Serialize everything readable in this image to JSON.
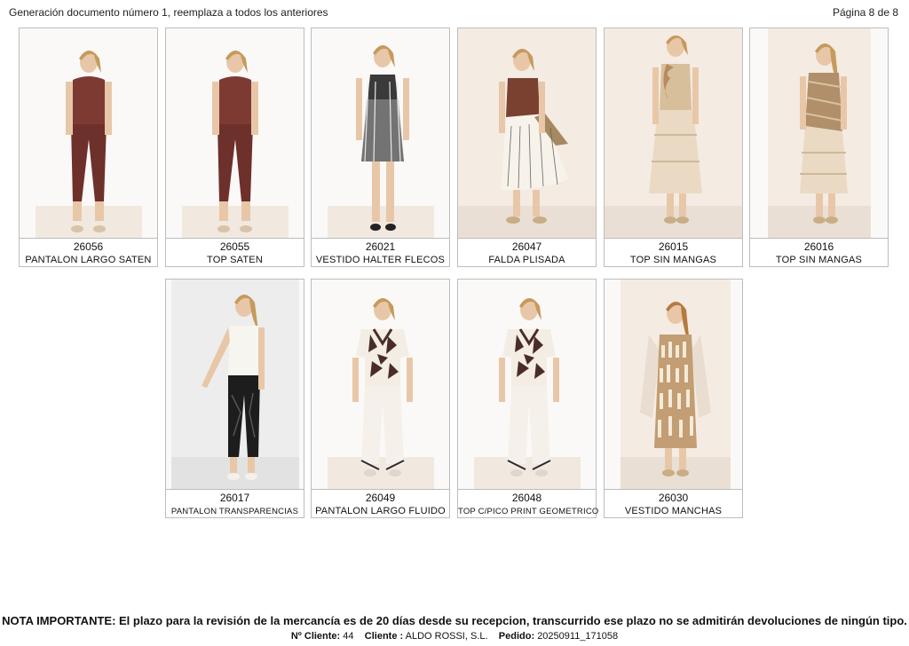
{
  "header": {
    "title": "Generación documento número 1, reemplaza a todos los anteriores",
    "page": "Página 8 de 8"
  },
  "products": [
    {
      "code": "26056",
      "name": "PANTALON LARGO SATEN",
      "photo": "model-wearing-pantalon-largo-saten"
    },
    {
      "code": "26055",
      "name": "TOP SATEN",
      "photo": "model-wearing-top-saten"
    },
    {
      "code": "26021",
      "name": "VESTIDO HALTER FLECOS",
      "photo": "model-wearing-vestido-halter-flecos"
    },
    {
      "code": "26047",
      "name": "FALDA PLISADA",
      "photo": "model-wearing-falda-plisada"
    },
    {
      "code": "26015",
      "name": "TOP SIN MANGAS",
      "photo": "model-wearing-top-sin-mangas"
    },
    {
      "code": "26016",
      "name": "TOP SIN MANGAS",
      "photo": "model-wearing-top-sin-mangas-2"
    },
    {
      "code": "26017",
      "name": "PANTALON TRANSPARENCIAS",
      "photo": "model-wearing-pantalon-transparencias"
    },
    {
      "code": "26049",
      "name": "PANTALON LARGO FLUIDO",
      "photo": "model-wearing-pantalon-largo-fluido"
    },
    {
      "code": "26048",
      "name": "TOP C/PICO PRINT GEOMETRICO",
      "photo": "model-wearing-top-pico-print-geometrico"
    },
    {
      "code": "26030",
      "name": "VESTIDO MANCHAS",
      "photo": "model-wearing-vestido-manchas"
    }
  ],
  "note": "NOTA IMPORTANTE: El plazo para la revisión de la mercancía es de 20 días desde su recepcion, transcurrido ese plazo no se admitirán devoluciones de ningún tipo.",
  "footer": {
    "client_no_label": "Nº Cliente:",
    "client_no": "44",
    "client_label": "Cliente :",
    "client": "ALDO ROSSI, S.L.",
    "order_label": "Pedido:",
    "order": "20250911_171058"
  }
}
